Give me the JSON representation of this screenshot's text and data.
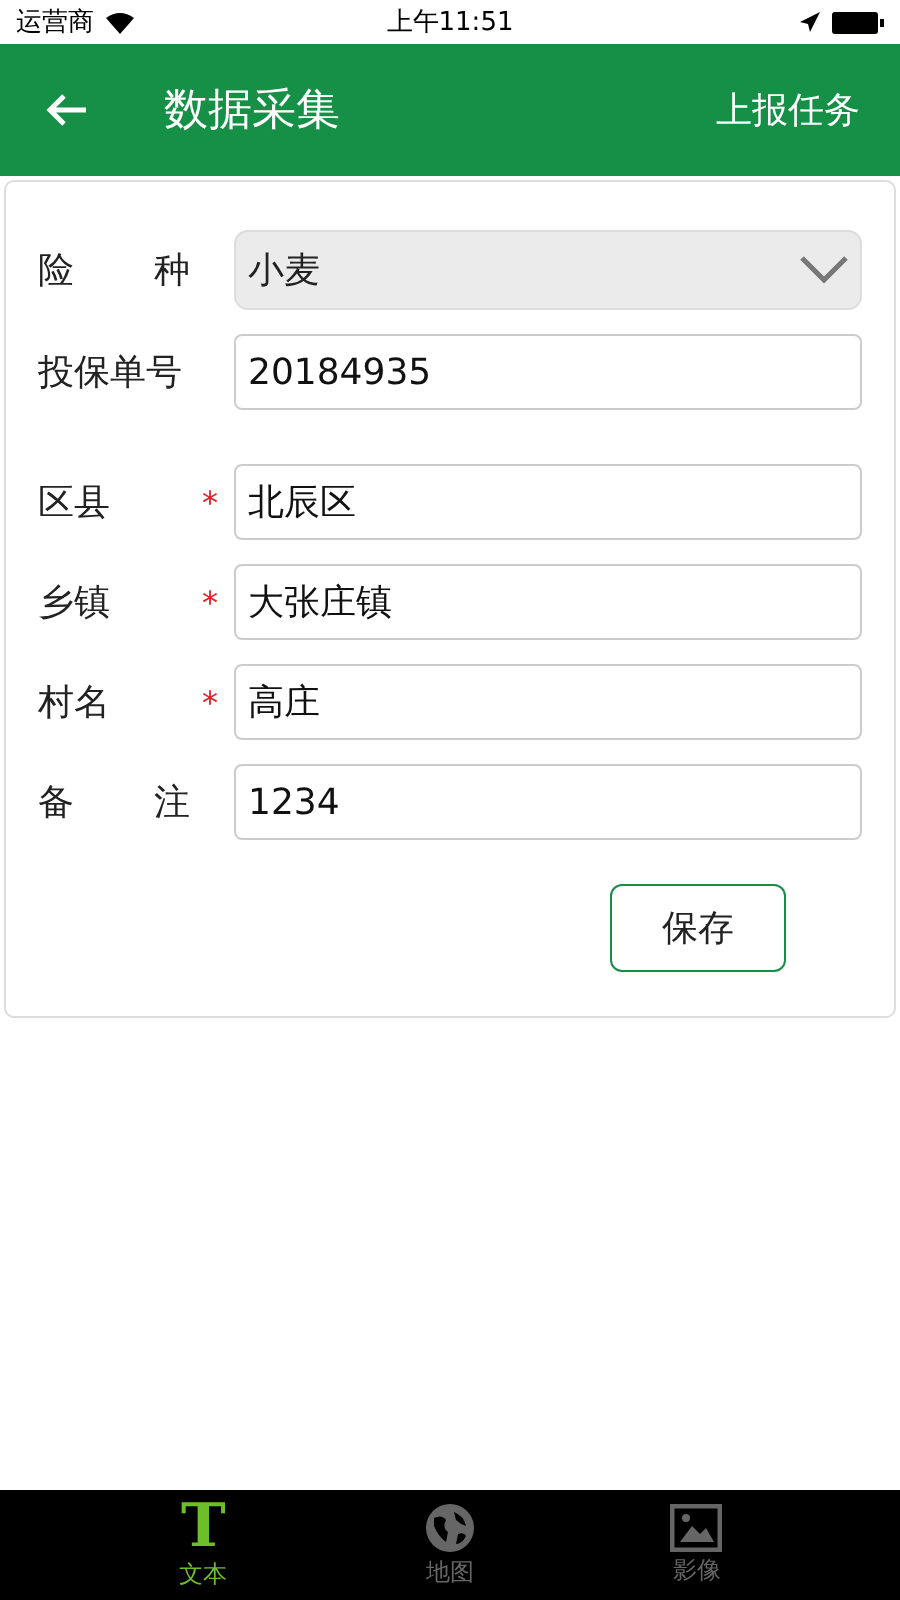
{
  "status_bar": {
    "carrier": "运营商",
    "time": "上午11:51"
  },
  "header": {
    "title": "数据采集",
    "action": "上报任务"
  },
  "field_groups": [
    [
      {
        "kind": "select",
        "label": "险种",
        "required": false,
        "value": "小麦"
      },
      {
        "kind": "input",
        "label": "投保单号",
        "required": false,
        "value": "20184935"
      }
    ],
    [
      {
        "kind": "input",
        "label": "区县",
        "required": true,
        "value": "北辰区"
      },
      {
        "kind": "input",
        "label": "乡镇",
        "required": true,
        "value": "大张庄镇"
      },
      {
        "kind": "input",
        "label": "村名",
        "required": true,
        "value": "高庄"
      },
      {
        "kind": "input",
        "label": "备注",
        "required": false,
        "value": "1234"
      }
    ]
  ],
  "required_mark": "*",
  "save_button": "保存",
  "tabs": [
    {
      "label": "文本",
      "icon": "T",
      "selected": true
    },
    {
      "label": "地图",
      "selected": false
    },
    {
      "label": "影像",
      "selected": false
    }
  ]
}
